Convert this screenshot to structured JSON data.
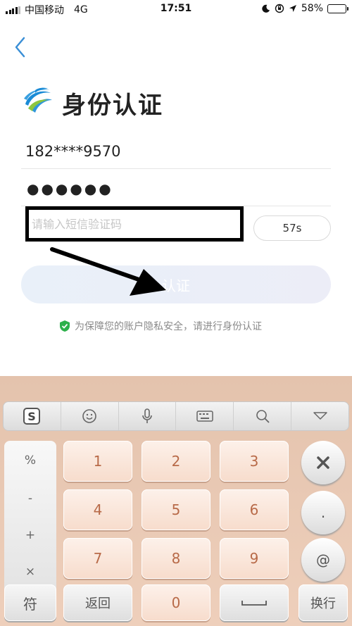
{
  "status_bar": {
    "carrier": "中国移动",
    "network": "4G",
    "time": "17:51",
    "battery_percent": "58%",
    "battery_level": 0.58,
    "battery_color": "#f1c400",
    "icons": [
      "moon-icon",
      "orientation-lock-icon",
      "location-icon"
    ]
  },
  "header": {
    "back_icon": "chevron-left-icon",
    "title": "身份认证",
    "logo": "china-mobile-logo"
  },
  "form": {
    "phone": "182****9570",
    "password_mask": "●●●●●●",
    "sms_placeholder": "请输入短信验证码",
    "countdown_label": "57s",
    "submit_label": "认证"
  },
  "notice": {
    "icon": "shield-check-icon",
    "text": "为保障您的账户隐私安全，请进行身份认证"
  },
  "keyboard": {
    "toolbar": [
      "sogou-logo-icon",
      "emoji-icon",
      "microphone-icon",
      "keyboard-icon",
      "search-icon",
      "collapse-icon"
    ],
    "symbols": [
      "%",
      "-",
      "+",
      "×"
    ],
    "digits": [
      "1",
      "2",
      "3",
      "4",
      "5",
      "6",
      "7",
      "8",
      "9"
    ],
    "right_keys": {
      "delete_icon": "delete-icon",
      "dot": ".",
      "at": "@"
    },
    "bottom": {
      "symbol": "符",
      "back": "返回",
      "zero": "0",
      "space_icon": "space-icon",
      "enter": "换行"
    }
  },
  "colors": {
    "accent": "#3a8fd6",
    "keyboard_bg": "#e9c8b3",
    "key_text": "#b86a48",
    "shield": "#2db04b"
  }
}
